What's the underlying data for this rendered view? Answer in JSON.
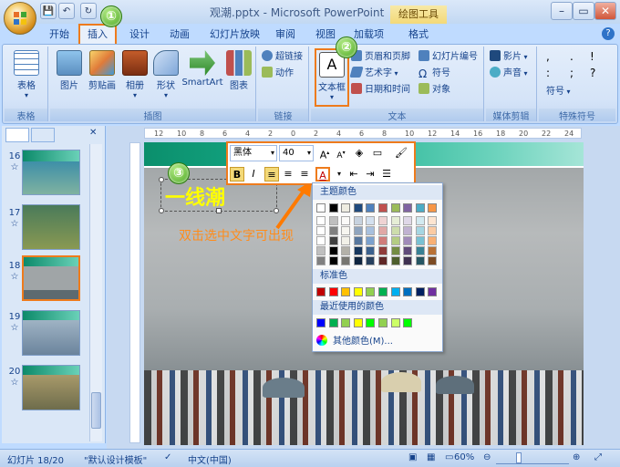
{
  "window": {
    "title": "观潮.pptx - Microsoft PowerPoint",
    "contextual_tab_header": "绘图工具"
  },
  "tabs": [
    {
      "label": "开始"
    },
    {
      "label": "插入"
    },
    {
      "label": "设计"
    },
    {
      "label": "动画"
    },
    {
      "label": "幻灯片放映"
    },
    {
      "label": "审阅"
    },
    {
      "label": "视图"
    },
    {
      "label": "加载项"
    },
    {
      "label": "格式"
    }
  ],
  "ribbon": {
    "groups": {
      "table": {
        "label": "表格",
        "buttons": [
          "表格"
        ]
      },
      "illustrations": {
        "label": "插图",
        "buttons": [
          "图片",
          "剪贴画",
          "相册",
          "形状",
          "SmartArt",
          "图表"
        ]
      },
      "links": {
        "label": "链接",
        "buttons": [
          "超链接",
          "动作"
        ]
      },
      "text": {
        "label": "文本",
        "big_button": "文本框",
        "small_buttons": [
          "页眉和页脚",
          "艺术字",
          "日期和时间",
          "幻灯片编号",
          "符号",
          "对象"
        ]
      },
      "media": {
        "label": "媒体剪辑",
        "buttons": [
          "影片",
          "声音"
        ]
      },
      "special": {
        "label": "特殊符号",
        "chars": [
          ",",
          ".",
          ":",
          ";",
          "?",
          "!"
        ],
        "button": "符号"
      }
    }
  },
  "badges": [
    "①",
    "②",
    "③"
  ],
  "slides_pane": {
    "thumbnails": [
      {
        "number": "16",
        "star": "☆"
      },
      {
        "number": "17",
        "star": "☆"
      },
      {
        "number": "18",
        "star": "☆"
      },
      {
        "number": "19",
        "star": "☆"
      },
      {
        "number": "20",
        "star": "☆"
      }
    ],
    "selected_index": 2
  },
  "ruler": {
    "ticks": [
      "12",
      "10",
      "8",
      "6",
      "4",
      "2",
      "0",
      "2",
      "4",
      "6",
      "8",
      "10",
      "12",
      "14",
      "16",
      "18",
      "20",
      "22",
      "24"
    ]
  },
  "slide": {
    "title_text": "一线潮",
    "annotation": "双击选中文字可出现"
  },
  "mini_toolbar": {
    "font": "黑体",
    "size": "40"
  },
  "color_picker": {
    "theme_header": "主题颜色",
    "standard_header": "标准色",
    "recent_header": "最近使用的颜色",
    "more_colors": "其他颜色(M)...",
    "theme_colors": [
      "#ffffff",
      "#000000",
      "#eeece1",
      "#1f497d",
      "#4f81bd",
      "#c0504d",
      "#9bbb59",
      "#8064a2",
      "#4bacc6",
      "#f79646"
    ],
    "standard_colors": [
      "#c00000",
      "#ff0000",
      "#ffc000",
      "#ffff00",
      "#92d050",
      "#00b050",
      "#00b0f0",
      "#0070c0",
      "#002060",
      "#7030a0"
    ],
    "recent_colors": [
      "#0000ff",
      "#00b050",
      "#92d050",
      "#ffff00",
      "#00ff00",
      "#92d050",
      "#ccff66",
      "#00ff00"
    ]
  },
  "status_bar": {
    "slide_info": "幻灯片 18/20",
    "template": "\"默认设计模板\"",
    "language": "中文(中国)",
    "zoom": "60%"
  }
}
